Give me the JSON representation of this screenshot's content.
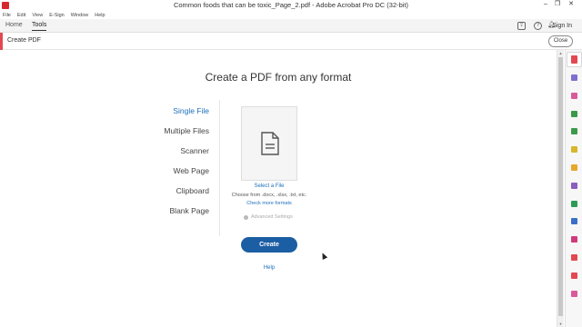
{
  "window": {
    "title": "Common foods that can be toxic_Page_2.pdf - Adobe Acrobat Pro DC (32-bit)",
    "minimize": "–",
    "restore": "❐",
    "close": "✕"
  },
  "menu": [
    "File",
    "Edit",
    "View",
    "E-Sign",
    "Window",
    "Help"
  ],
  "tabs": {
    "home": "Home",
    "tools": "Tools",
    "signin": "Sign In"
  },
  "tool": {
    "name": "Create PDF",
    "close_label": "Close"
  },
  "main": {
    "title": "Create a PDF from any format",
    "options": [
      "Single File",
      "Multiple Files",
      "Scanner",
      "Web Page",
      "Clipboard",
      "Blank Page"
    ],
    "active_option": "Single File",
    "select_file": "Select a File",
    "choose_from": "Choose from .docx, .xlsx, .txt, etc.",
    "more_formats": "Check more formats",
    "advanced_settings": "Advanced Settings",
    "create_label": "Create",
    "help_label": "Help"
  },
  "colors": {
    "accent_red": "#e34850",
    "link_blue": "#1e6fb9",
    "button_blue": "#1c5ea3"
  },
  "right_pane_icons": [
    {
      "name": "create-pdf-icon",
      "color": "#e34850"
    },
    {
      "name": "combine-files-icon",
      "color": "#7f6fd0"
    },
    {
      "name": "organize-pages-icon",
      "color": "#d95a9b"
    },
    {
      "name": "export-pdf-icon",
      "color": "#3b9a4a"
    },
    {
      "name": "edit-pdf-icon",
      "color": "#3b9a4a"
    },
    {
      "name": "scan-ocr-icon",
      "color": "#d8b52a"
    },
    {
      "name": "comment-icon",
      "color": "#e8a62a"
    },
    {
      "name": "fill-sign-icon",
      "color": "#8b5fbf"
    },
    {
      "name": "print-production-icon",
      "color": "#2e9b55"
    },
    {
      "name": "protect-icon",
      "color": "#3b6fc7"
    },
    {
      "name": "request-signatures-icon",
      "color": "#d03a7a"
    },
    {
      "name": "compare-files-icon",
      "color": "#e34850"
    },
    {
      "name": "optimize-pdf-icon",
      "color": "#e34850"
    },
    {
      "name": "more-tools-icon",
      "color": "#d95a9b"
    }
  ]
}
